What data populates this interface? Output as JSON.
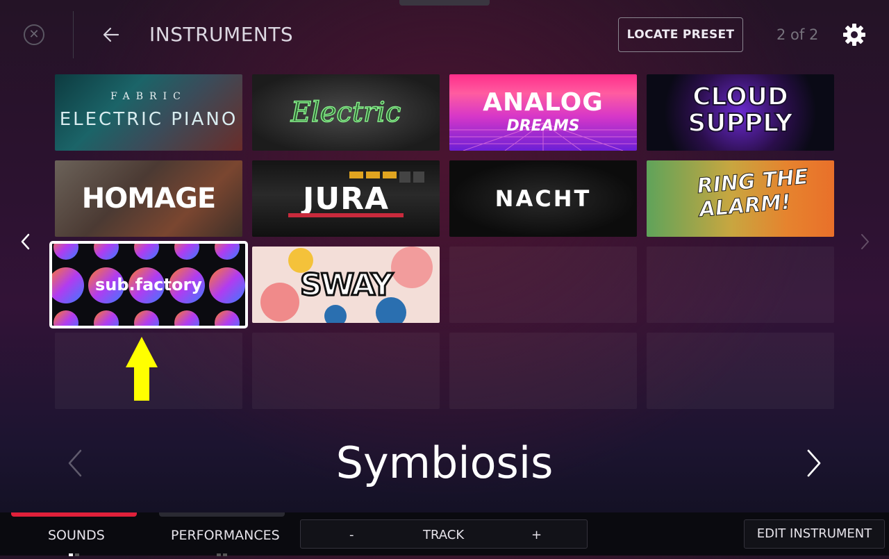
{
  "header": {
    "title": "INSTRUMENTS",
    "locate_label": "LOCATE PRESET",
    "page_indicator": "2 of 2"
  },
  "instruments": [
    {
      "name": "FABRIC",
      "subtitle": "ELECTRIC PIANO"
    },
    {
      "name": "Electric"
    },
    {
      "name": "ANALOG",
      "subtitle": "DREAMS"
    },
    {
      "name": "CLOUD",
      "subtitle": "SUPPLY"
    },
    {
      "name": "HOMAGE"
    },
    {
      "name": "JURA"
    },
    {
      "name": "NACHT"
    },
    {
      "name": "RING THE",
      "subtitle": "ALARM!"
    },
    {
      "name": "sub.factory",
      "selected": true
    },
    {
      "name": "SWAY"
    }
  ],
  "preset": {
    "name": "Symbiosis"
  },
  "bottom": {
    "tabs": [
      {
        "label": "SOUNDS",
        "active": true
      },
      {
        "label": "PERFORMANCES",
        "active": false
      }
    ],
    "track": {
      "minus": "-",
      "label": "TRACK",
      "plus": "+"
    },
    "edit_label": "EDIT INSTRUMENT"
  },
  "colors": {
    "accent": "#e0203a",
    "annotation_arrow": "#ffff00",
    "selected_border": "#ffffff"
  },
  "icons": [
    "close-icon",
    "back-arrow-icon",
    "gear-icon",
    "chevron-left-icon",
    "chevron-right-icon"
  ]
}
